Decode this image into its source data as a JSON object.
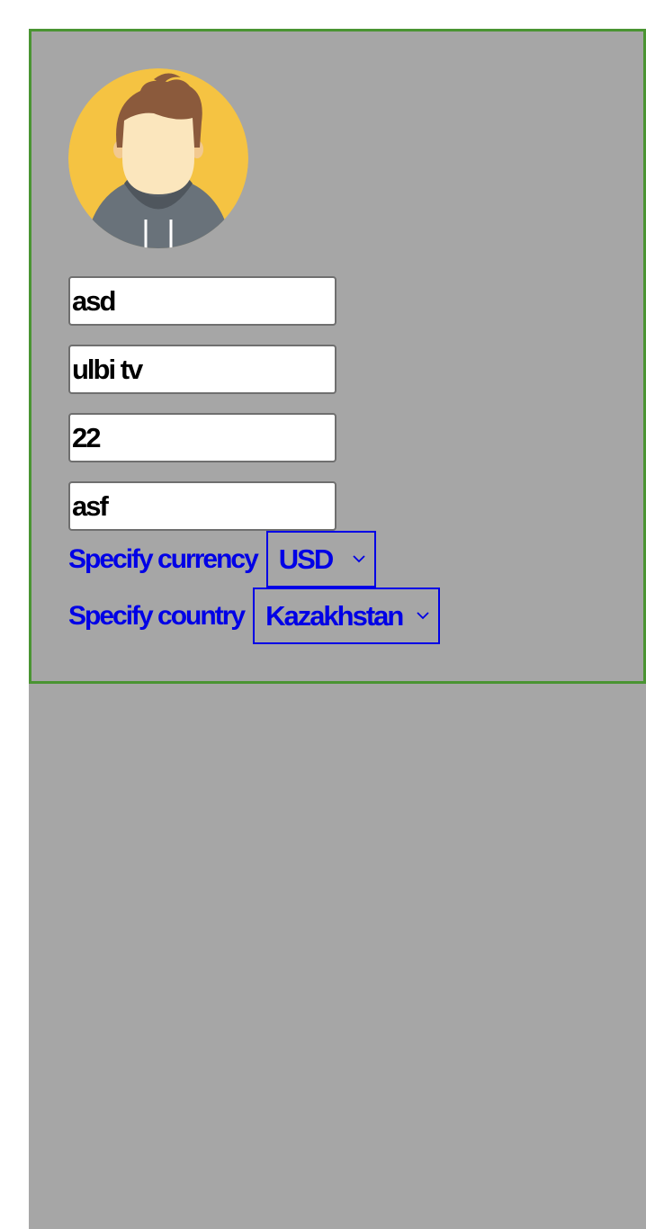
{
  "profile": {
    "avatar_icon": "user-avatar-icon",
    "fields": [
      {
        "name": "first-name",
        "value": "asd"
      },
      {
        "name": "last-name",
        "value": "ulbi tv"
      },
      {
        "name": "age",
        "value": "22"
      },
      {
        "name": "address",
        "value": "asf"
      }
    ],
    "currency": {
      "label": "Specify currency",
      "selected": "USD"
    },
    "country": {
      "label": "Specify country",
      "selected": "Kazakhstan"
    }
  },
  "colors": {
    "card_border": "#4a9432",
    "background": "#a6a6a6",
    "accent_blue": "#0000e6",
    "avatar_bg": "#f5c342"
  }
}
